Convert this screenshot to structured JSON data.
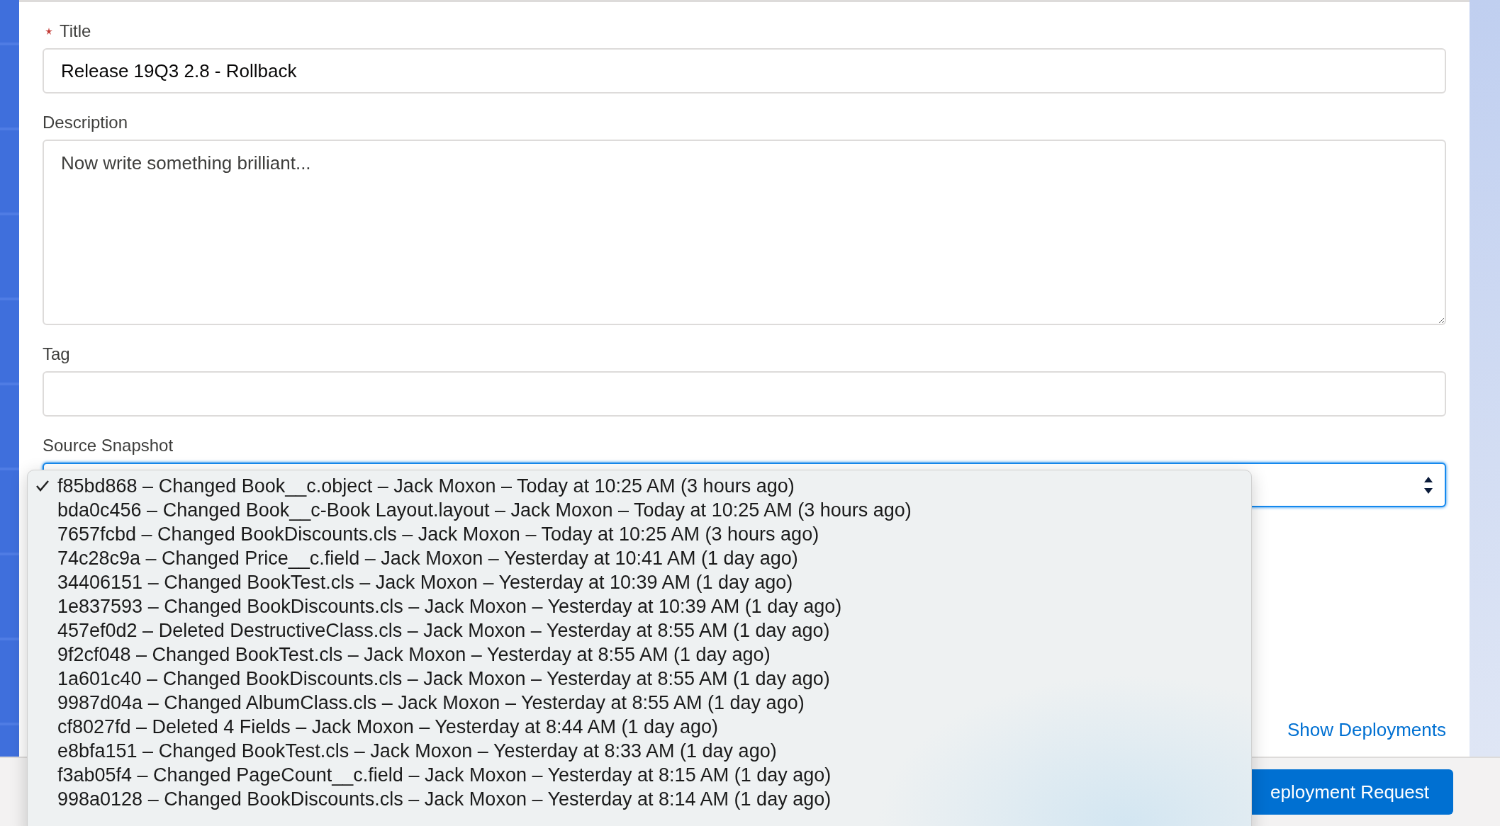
{
  "form": {
    "fields": [
      {
        "kind": "text",
        "label": "Title",
        "required": true,
        "value": "Release 19Q3 2.8 - Rollback"
      },
      {
        "kind": "textarea",
        "label": "Description",
        "placeholder": "Now write something brilliant..."
      },
      {
        "kind": "text",
        "label": "Tag"
      },
      {
        "kind": "select",
        "label": "Source Snapshot",
        "focused": true
      }
    ]
  },
  "source_snapshot_menu": {
    "items": [
      {
        "label": "f85bd868 – Changed Book__c.object – Jack Moxon – Today at 10:25 AM (3 hours ago)",
        "selected": true
      },
      {
        "label": "bda0c456 – Changed Book__c-Book Layout.layout – Jack Moxon – Today at 10:25 AM (3 hours ago)",
        "selected": false
      },
      {
        "label": "7657fcbd – Changed BookDiscounts.cls – Jack Moxon – Today at 10:25 AM (3 hours ago)",
        "selected": false
      },
      {
        "label": "74c28c9a – Changed Price__c.field – Jack Moxon – Yesterday at 10:41 AM (1 day ago)",
        "selected": false
      },
      {
        "label": "34406151 – Changed BookTest.cls – Jack Moxon – Yesterday at 10:39 AM (1 day ago)",
        "selected": false
      },
      {
        "label": "1e837593 – Changed BookDiscounts.cls – Jack Moxon – Yesterday at 10:39 AM (1 day ago)",
        "selected": false
      },
      {
        "label": "457ef0d2 – Deleted DestructiveClass.cls – Jack Moxon – Yesterday at 8:55 AM (1 day ago)",
        "selected": false
      },
      {
        "label": "9f2cf048 – Changed BookTest.cls – Jack Moxon – Yesterday at 8:55 AM (1 day ago)",
        "selected": false
      },
      {
        "label": "1a601c40 – Changed BookDiscounts.cls – Jack Moxon – Yesterday at 8:55 AM (1 day ago)",
        "selected": false
      },
      {
        "label": "9987d04a – Changed AlbumClass.cls – Jack Moxon – Yesterday at 8:55 AM (1 day ago)",
        "selected": false
      },
      {
        "label": "cf8027fd – Deleted 4 Fields – Jack Moxon – Yesterday at 8:44 AM (1 day ago)",
        "selected": false
      },
      {
        "label": "e8bfa151 – Changed BookTest.cls – Jack Moxon – Yesterday at 8:33 AM (1 day ago)",
        "selected": false
      },
      {
        "label": "f3ab05f4 – Changed PageCount__c.field – Jack Moxon – Yesterday at 8:15 AM (1 day ago)",
        "selected": false
      },
      {
        "label": "998a0128 – Changed BookDiscounts.cls – Jack Moxon – Yesterday at 8:14 AM (1 day ago)",
        "selected": false
      }
    ]
  },
  "show_deployments_link": "Show Deployments",
  "footer": {
    "button": "eployment Request"
  }
}
